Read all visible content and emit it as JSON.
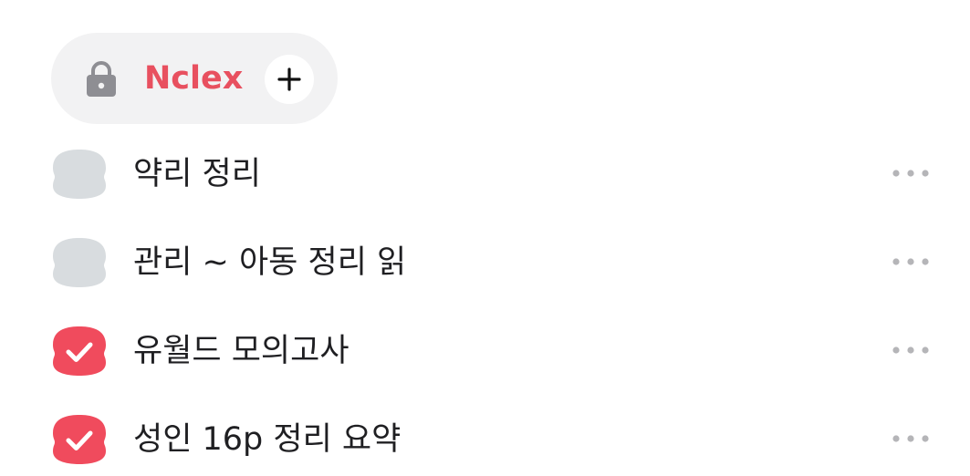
{
  "category": {
    "title": "Nclex",
    "lock_icon": "lock-icon",
    "add_icon": "plus-icon",
    "accent_color": "#e8505f"
  },
  "todos": [
    {
      "text": "약리 정리",
      "done": false
    },
    {
      "text": "관리 ~ 아동 정리 읽",
      "done": false
    },
    {
      "text": "유월드 모의고사",
      "done": true
    },
    {
      "text": "성인 16p 정리 요약",
      "done": true
    }
  ],
  "colors": {
    "done": "#f04b5d",
    "pending": "#d8dcdf",
    "text": "#1f1f22",
    "more_dots": "#b5b5b8"
  }
}
